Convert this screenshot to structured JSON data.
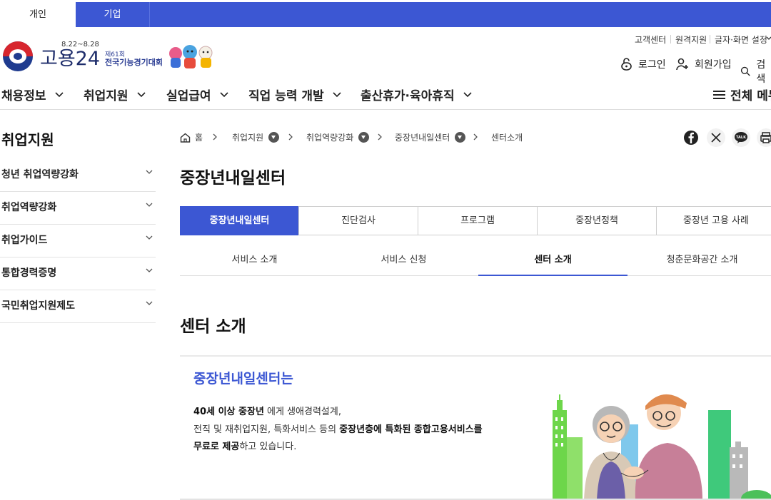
{
  "top_tabs": [
    {
      "label": "개인",
      "active": true
    },
    {
      "label": "기업",
      "active": false
    }
  ],
  "logo": {
    "text": "고용24",
    "event_dates": "8.22~8.28",
    "event_edition": "제61회",
    "event_name": "전국기능경기대회"
  },
  "util_links": [
    "고객센터",
    "원격지원",
    "글자·화면 설정"
  ],
  "header_buttons": {
    "login": "로그인",
    "signup": "회원가입",
    "search": "검색"
  },
  "gnb": {
    "items": [
      "채용정보",
      "취업지원",
      "실업급여",
      "직업 능력 개발",
      "출산휴가·육아휴직"
    ],
    "all_menu": "전체 메뉴"
  },
  "sidebar": {
    "title": "취업지원",
    "items": [
      "청년 취업역량강화",
      "취업역량강화",
      "취업가이드",
      "통합경력증명",
      "국민취업지원제도"
    ]
  },
  "breadcrumb": {
    "home": "홈",
    "items": [
      "취업지원",
      "취업역량강화",
      "중장년내일센터",
      "센터소개"
    ]
  },
  "share_icons": [
    "facebook-icon",
    "x-icon",
    "kakaotalk-icon",
    "print-icon"
  ],
  "share_labels": {
    "talk": "TALK"
  },
  "page_title": "중장년내일센터",
  "main_tabs": [
    {
      "label": "중장년내일센터",
      "active": true
    },
    {
      "label": "진단검사",
      "active": false
    },
    {
      "label": "프로그램",
      "active": false
    },
    {
      "label": "중장년정책",
      "active": false
    },
    {
      "label": "중장년 고용 사례",
      "active": false
    }
  ],
  "sub_tabs": [
    {
      "label": "서비스 소개",
      "active": false
    },
    {
      "label": "서비스 신청",
      "active": false
    },
    {
      "label": "센터 소개",
      "active": true
    },
    {
      "label": "청춘문화공간 소개",
      "active": false
    }
  ],
  "section": {
    "title": "센터 소개",
    "intro_title": "중장년내일센터는",
    "line1_bold": "40세 이상 중장년",
    "line1_rest": " 에게 생애경력설계,",
    "line2_plain": "전직 및 재취업지원, 특화서비스 등의 ",
    "line2_bold": "중장년층에 특화된 종합고용서비스를",
    "line3_bold": "무료로 제공",
    "line3_rest": "하고 있습니다."
  },
  "colors": {
    "brand_blue": "#3c57d3",
    "logo_navy": "#1e2d6b",
    "taegeuk_red": "#d7262e"
  }
}
